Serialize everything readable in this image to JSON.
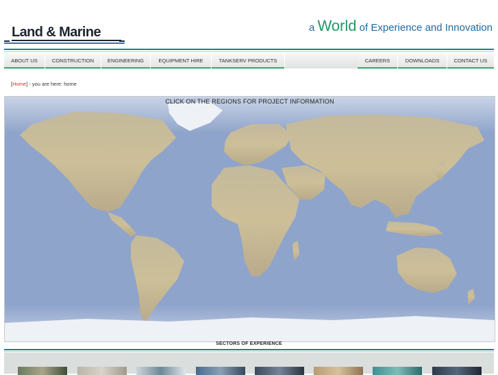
{
  "header": {
    "logo_text": "Land & Marine",
    "tagline_prefix": "a ",
    "tagline_big": "World",
    "tagline_suffix": " of Experience and Innovation",
    "colors": {
      "teal_rule": "#1b7f95",
      "green": "#1d9a69",
      "nav_underline": "#3ba26c"
    }
  },
  "nav": {
    "left": [
      {
        "label": "About Us"
      },
      {
        "label": "Construction"
      },
      {
        "label": "Engineering"
      },
      {
        "label": "Equipment Hire"
      },
      {
        "label": "Tankserv Products"
      }
    ],
    "right": [
      {
        "label": "Careers"
      },
      {
        "label": "Downloads"
      },
      {
        "label": "Contact Us"
      }
    ]
  },
  "breadcrumb": {
    "open": "[",
    "home_link": "Home",
    "rest": "] - you are here: home"
  },
  "map": {
    "caption": "CLICK ON THE REGIONS FOR PROJECT INFORMATION",
    "regions": [
      "north-america",
      "south-america",
      "europe",
      "africa",
      "middle-east",
      "asia",
      "australia",
      "greenland",
      "antarctica"
    ]
  },
  "sectors": {
    "title": "SECTORS OF EXPERIENCE",
    "thumbnails": [
      "sector-1",
      "sector-2",
      "sector-3",
      "sector-4",
      "sector-5",
      "sector-6",
      "sector-7",
      "sector-8"
    ]
  }
}
